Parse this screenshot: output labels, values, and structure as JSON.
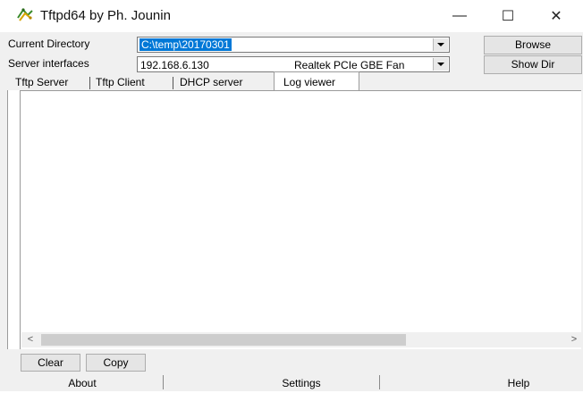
{
  "window": {
    "title": "Tftpd64 by Ph. Jounin",
    "controls": {
      "minimize": "—",
      "maximize": "☐",
      "close": "✕"
    }
  },
  "current_directory": {
    "label": "Current Directory",
    "value": "C:\\temp\\20170301",
    "button": "Browse"
  },
  "server_interfaces": {
    "label": "Server interfaces",
    "ip": "192.168.6.130",
    "adapter": "Realtek PCIe GBE Fan",
    "button": "Show Dir"
  },
  "tabs": [
    {
      "label": "Tftp Server",
      "active": false
    },
    {
      "label": "Tftp Client",
      "active": false
    },
    {
      "label": "DHCP server",
      "active": false
    },
    {
      "label": "Log viewer",
      "active": true
    }
  ],
  "log": {
    "entries": [],
    "scroll_left_glyph": "<",
    "scroll_right_glyph": ">"
  },
  "actions": {
    "clear": "Clear",
    "copy": "Copy"
  },
  "bottom": {
    "about": "About",
    "settings": "Settings",
    "help": "Help"
  },
  "colors": {
    "selection": "#0078d7",
    "window_bg": "#f0f0f0"
  }
}
